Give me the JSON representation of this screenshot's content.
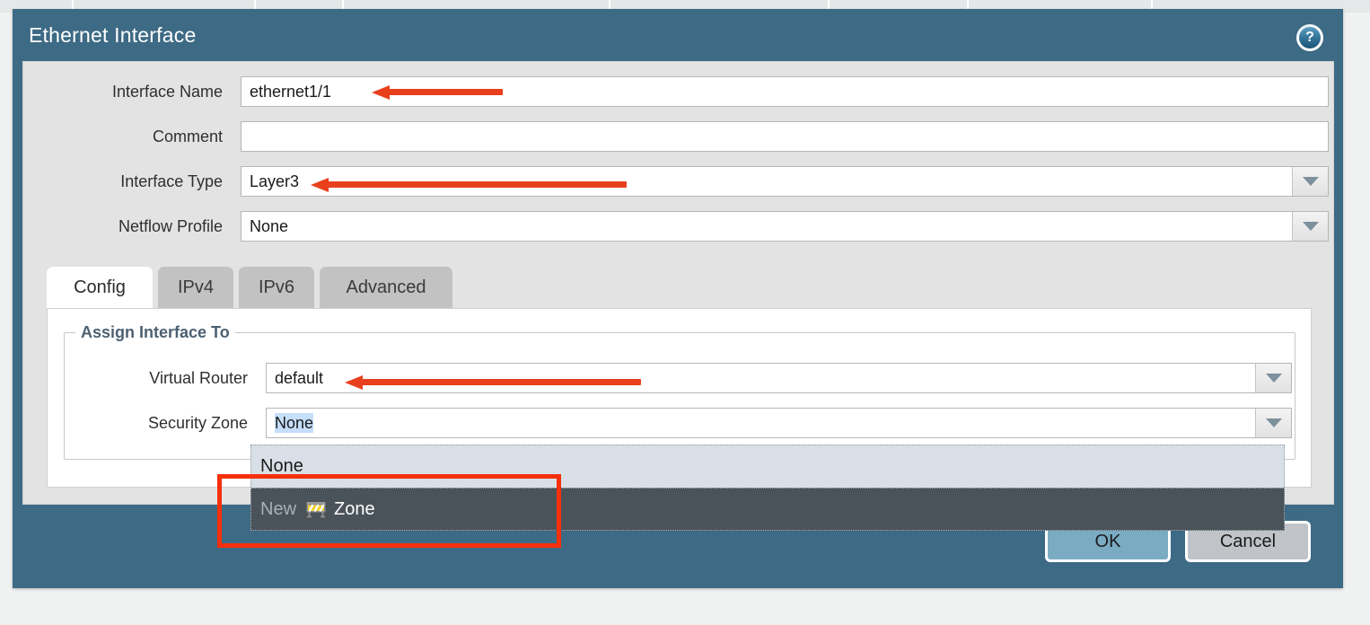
{
  "dialog": {
    "title": "Ethernet Interface",
    "help_icon": "help-question-icon",
    "help_glyph": "?",
    "accent_header": "#3d6a85",
    "body_bg": "#e3e3e3"
  },
  "form": {
    "rows": [
      {
        "label": "Interface Name",
        "value": "ethernet1/1",
        "has_dropdown": false
      },
      {
        "label": "Comment",
        "value": "",
        "has_dropdown": false
      },
      {
        "label": "Interface Type",
        "value": "Layer3",
        "has_dropdown": true
      },
      {
        "label": "Netflow Profile",
        "value": "None",
        "has_dropdown": true
      }
    ]
  },
  "tabs": [
    {
      "label": "Config",
      "active": true
    },
    {
      "label": "IPv4",
      "active": false
    },
    {
      "label": "IPv6",
      "active": false
    },
    {
      "label": "Advanced",
      "active": false
    }
  ],
  "assign_section": {
    "legend": "Assign Interface To",
    "rows": [
      {
        "label": "Virtual Router",
        "value": "default"
      },
      {
        "label": "Security Zone",
        "value": "None"
      }
    ]
  },
  "dropdown": {
    "options": [
      {
        "label": "None",
        "kind": "plain"
      },
      {
        "label_prefix": "New",
        "icon": "zone-barricade-icon",
        "label_suffix": "Zone",
        "kind": "new"
      }
    ]
  },
  "footer": {
    "ok_label": "OK",
    "cancel_label": "Cancel",
    "ok_color": "#7aabc3",
    "cancel_color": "#c0c4c8"
  },
  "annotations": {
    "arrow_color": "#e8401c",
    "box_color": "#f5300b",
    "arrows": [
      {
        "target": "Interface Name"
      },
      {
        "target": "Interface Type"
      },
      {
        "target": "Virtual Router"
      }
    ],
    "boxes": [
      {
        "target": "New Zone"
      }
    ]
  }
}
